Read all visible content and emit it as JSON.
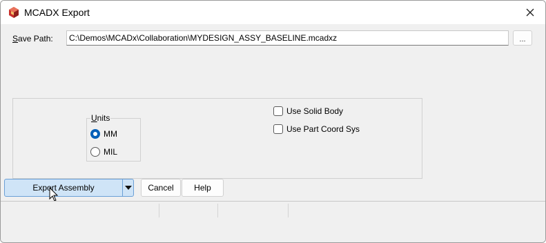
{
  "window": {
    "title": "MCADX Export",
    "app_icon": "mcadx-cube-icon",
    "close_icon": "close-icon"
  },
  "save_path": {
    "label_accel": "S",
    "label_rest": "ave Path:",
    "value": "C:\\Demos\\MCADx\\Collaboration\\MYDESIGN_ASSY_BASELINE.mcadxz",
    "browse_label": "..."
  },
  "units": {
    "legend_accel": "U",
    "legend_rest": "nits",
    "options": [
      {
        "label": "MM",
        "selected": true
      },
      {
        "label": "MIL",
        "selected": false
      }
    ]
  },
  "options": [
    {
      "label": "Use Solid Body",
      "checked": false
    },
    {
      "label": "Use Part Coord Sys",
      "checked": false
    }
  ],
  "buttons": {
    "export": "Export Assembly",
    "cancel": "Cancel",
    "help": "Help"
  },
  "colors": {
    "accent": "#005fb8",
    "export_bg": "#cfe4f7",
    "export_border": "#6a9fd6"
  }
}
